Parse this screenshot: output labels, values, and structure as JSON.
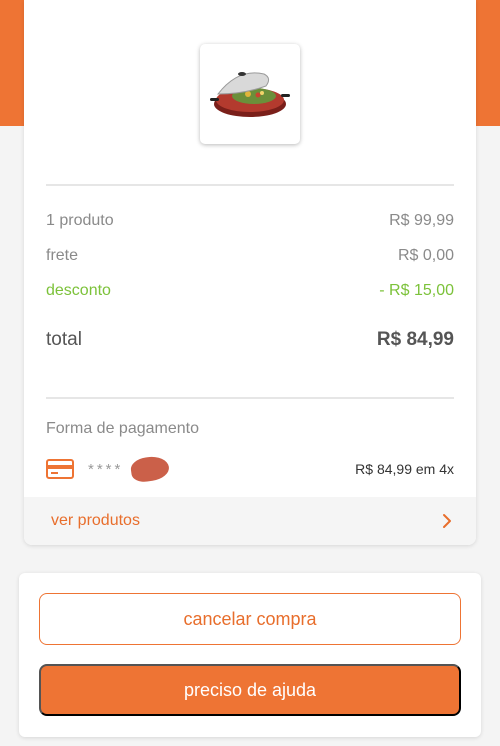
{
  "summary": {
    "product_count_label": "1 produto",
    "product_total": "R$ 99,99",
    "shipping_label": "frete",
    "shipping_value": "R$ 0,00",
    "discount_label": "desconto",
    "discount_value": "- R$ 15,00",
    "total_label": "total",
    "total_value": "R$ 84,99"
  },
  "payment": {
    "title": "Forma de pagamento",
    "card_icon": "credit-card-icon",
    "masked_number": "****",
    "installments": "R$ 84,99 em 4x"
  },
  "products_link": {
    "label": "ver produtos",
    "icon": "chevron-right-icon"
  },
  "actions": {
    "cancel_label": "cancelar compra",
    "help_label": "preciso de ajuda"
  },
  "colors": {
    "accent": "#ee7434",
    "discount": "#7cc23a"
  }
}
